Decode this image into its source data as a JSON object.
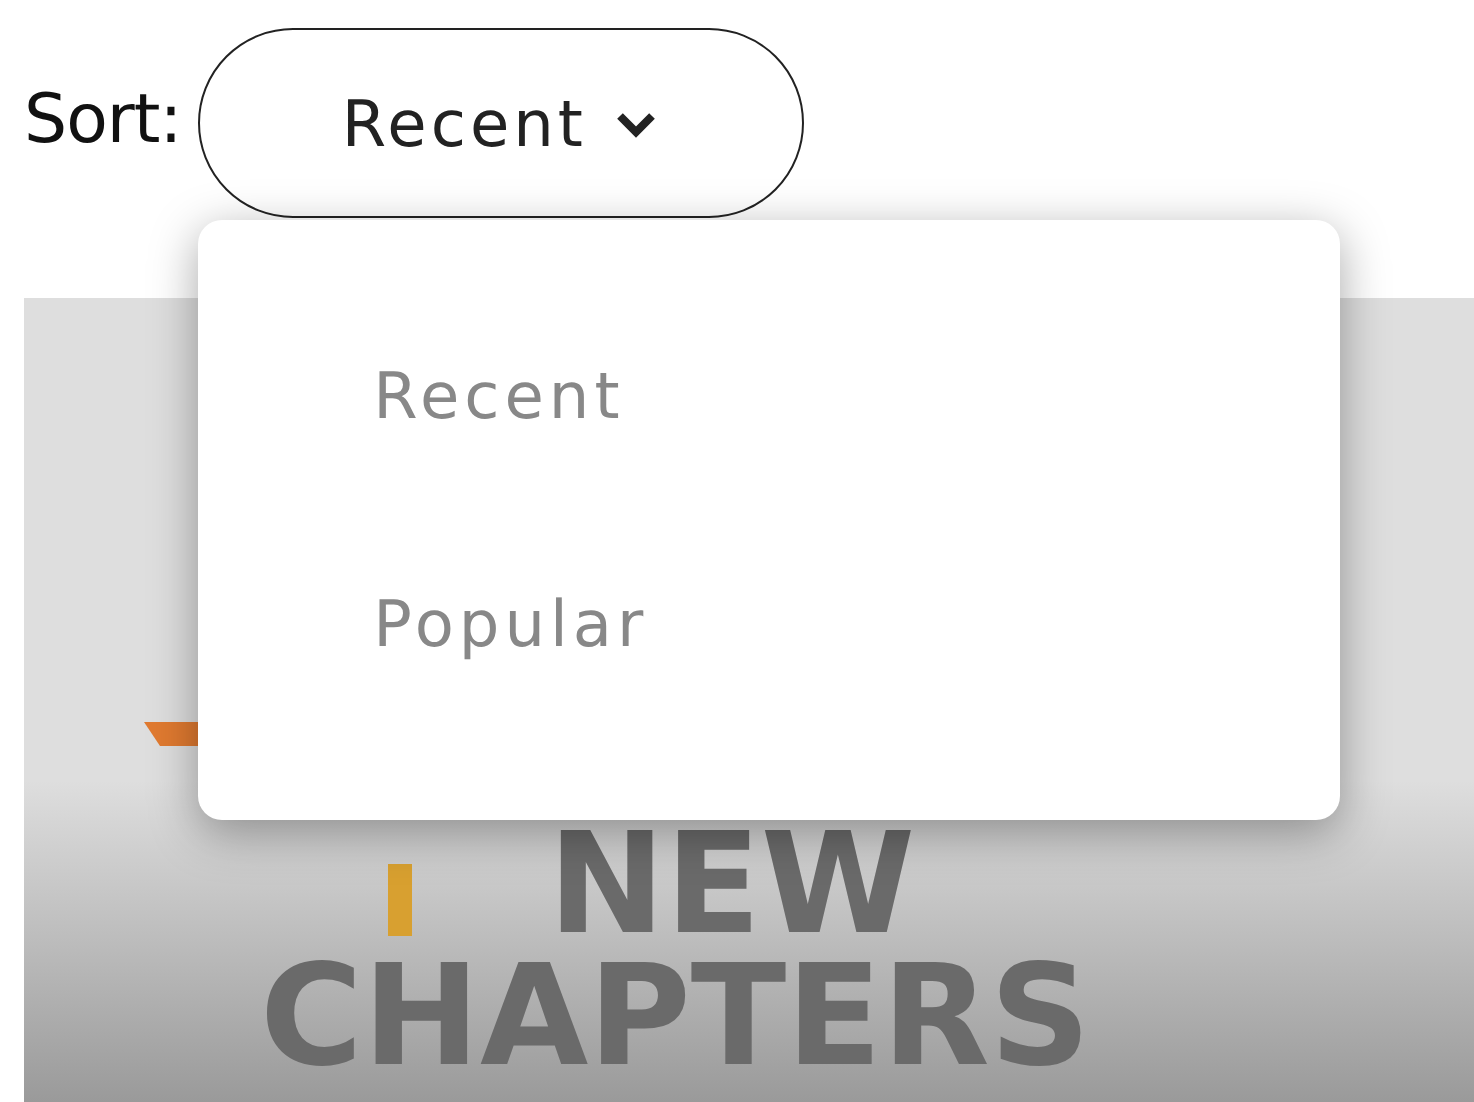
{
  "sort": {
    "label": "Sort:",
    "value": "Recent",
    "expanded": true,
    "options": [
      {
        "label": "Recent"
      },
      {
        "label": "Popular"
      }
    ]
  },
  "banner": {
    "line_1": "NEW",
    "line_2": "CHAPTERS"
  }
}
